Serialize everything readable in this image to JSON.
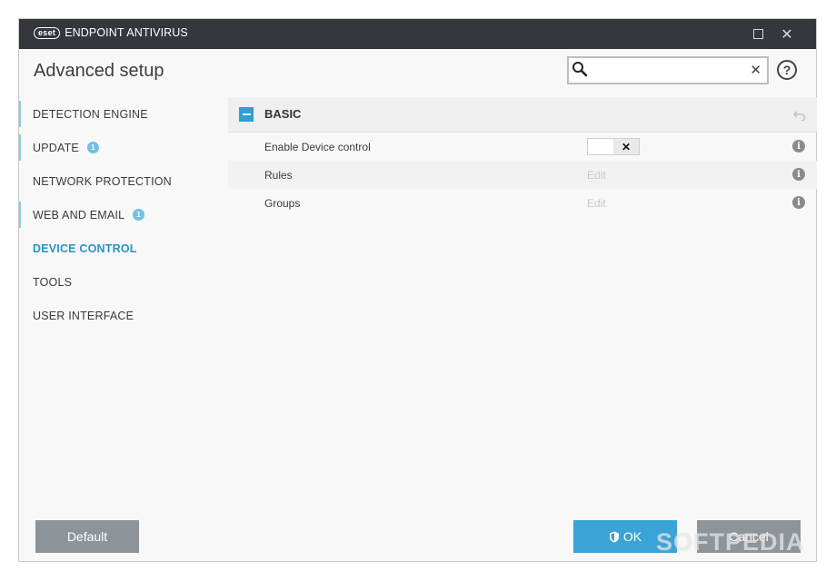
{
  "titlebar": {
    "logo_text": "eset",
    "product_name": "ENDPOINT ANTIVIRUS",
    "maximize_icon": "maximize-icon",
    "close_icon": "close-icon"
  },
  "header": {
    "title": "Advanced setup",
    "search": {
      "value": "",
      "placeholder": ""
    },
    "help_label": "?"
  },
  "sidebar": {
    "items": [
      {
        "label": "DETECTION ENGINE",
        "badge": ""
      },
      {
        "label": "UPDATE",
        "badge": "1"
      },
      {
        "label": "NETWORK PROTECTION",
        "badge": ""
      },
      {
        "label": "WEB AND EMAIL",
        "badge": "1"
      },
      {
        "label": "DEVICE CONTROL",
        "badge": "",
        "active": true
      },
      {
        "label": "TOOLS",
        "badge": ""
      },
      {
        "label": "USER INTERFACE",
        "badge": ""
      }
    ]
  },
  "main": {
    "section": {
      "title": "BASIC",
      "rows": [
        {
          "label": "Enable Device control",
          "toggle_state": "off",
          "toggle_symbol": "✕"
        },
        {
          "label": "Rules",
          "action": "Edit"
        },
        {
          "label": "Groups",
          "action": "Edit"
        }
      ]
    }
  },
  "footer": {
    "default_label": "Default",
    "ok_label": "OK",
    "cancel_label": "Cancel"
  },
  "watermark": "SOFTPEDIA",
  "colors": {
    "titlebar": "#34373b",
    "accent": "#2c9fd4",
    "active_nav": "#2a93c5",
    "badge": "#6fc0e5",
    "ok_button": "#3ba4d6",
    "neutral_button": "#8f9499"
  }
}
